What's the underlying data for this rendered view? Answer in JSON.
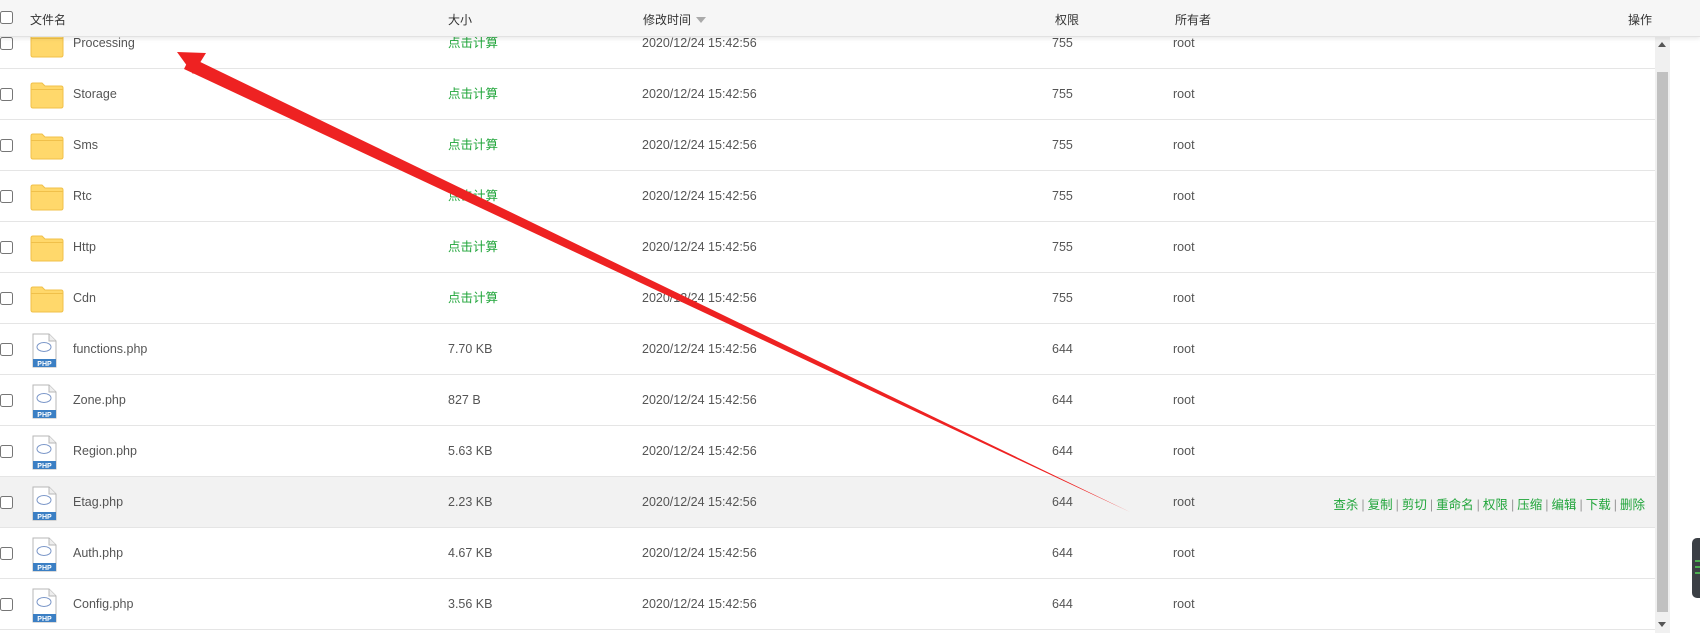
{
  "header": {
    "col_name": "文件名",
    "col_size": "大小",
    "col_mtime": "修改时间",
    "col_perm": "权限",
    "col_owner": "所有者",
    "col_ops": "操作"
  },
  "rows": [
    {
      "name": "Processing",
      "type": "folder",
      "size": "点击计算",
      "mtime": "2020/12/24 15:42:56",
      "perm": "755",
      "owner": "root"
    },
    {
      "name": "Storage",
      "type": "folder",
      "size": "点击计算",
      "mtime": "2020/12/24 15:42:56",
      "perm": "755",
      "owner": "root"
    },
    {
      "name": "Sms",
      "type": "folder",
      "size": "点击计算",
      "mtime": "2020/12/24 15:42:56",
      "perm": "755",
      "owner": "root"
    },
    {
      "name": "Rtc",
      "type": "folder",
      "size": "点击计算",
      "mtime": "2020/12/24 15:42:56",
      "perm": "755",
      "owner": "root"
    },
    {
      "name": "Http",
      "type": "folder",
      "size": "点击计算",
      "mtime": "2020/12/24 15:42:56",
      "perm": "755",
      "owner": "root"
    },
    {
      "name": "Cdn",
      "type": "folder",
      "size": "点击计算",
      "mtime": "2020/12/24 15:42:56",
      "perm": "755",
      "owner": "root"
    },
    {
      "name": "functions.php",
      "type": "php",
      "size": "7.70 KB",
      "mtime": "2020/12/24 15:42:56",
      "perm": "644",
      "owner": "root"
    },
    {
      "name": "Zone.php",
      "type": "php",
      "size": "827 B",
      "mtime": "2020/12/24 15:42:56",
      "perm": "644",
      "owner": "root"
    },
    {
      "name": "Region.php",
      "type": "php",
      "size": "5.63 KB",
      "mtime": "2020/12/24 15:42:56",
      "perm": "644",
      "owner": "root"
    },
    {
      "name": "Etag.php",
      "type": "php",
      "size": "2.23 KB",
      "mtime": "2020/12/24 15:42:56",
      "perm": "644",
      "owner": "root"
    },
    {
      "name": "Auth.php",
      "type": "php",
      "size": "4.67 KB",
      "mtime": "2020/12/24 15:42:56",
      "perm": "644",
      "owner": "root"
    },
    {
      "name": "Config.php",
      "type": "php",
      "size": "3.56 KB",
      "mtime": "2020/12/24 15:42:56",
      "perm": "644",
      "owner": "root"
    }
  ],
  "hover_row_index": 9,
  "row_actions": [
    "查杀",
    "复制",
    "剪切",
    "重命名",
    "权限",
    "压缩",
    "编辑",
    "下载",
    "删除"
  ],
  "icons": {
    "folder": "folder-icon",
    "php": "php-file-icon",
    "php_label": "PHP"
  },
  "colors": {
    "accent_green": "#20a53a",
    "arrow_red": "#ee2222",
    "folder_yellow": "#ffd86b",
    "php_blue": "#3b7fc4"
  }
}
